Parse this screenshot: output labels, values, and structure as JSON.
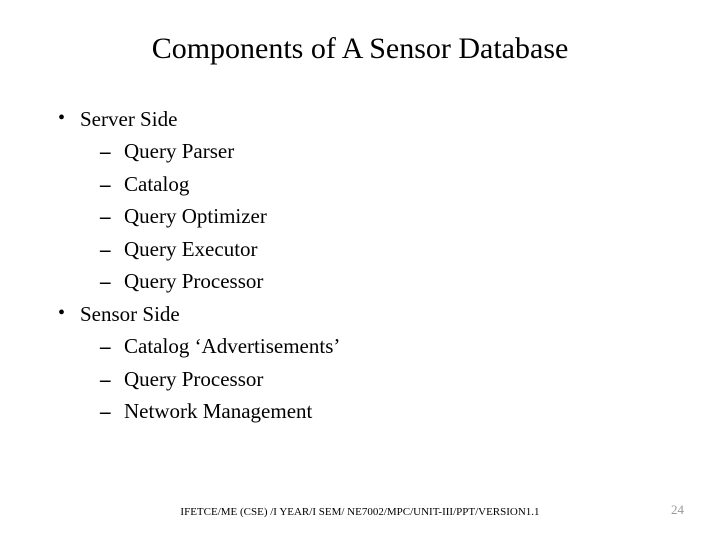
{
  "slide": {
    "title": "Components of A Sensor Database",
    "bullets": [
      {
        "label": "Server Side",
        "children": [
          "Query Parser",
          "Catalog",
          "Query Optimizer",
          "Query Executor",
          "Query Processor"
        ]
      },
      {
        "label": "Sensor Side",
        "children": [
          "Catalog ‘Advertisements’",
          "Query Processor",
          "Network Management"
        ]
      }
    ],
    "footer": "IFETCE/ME (CSE) /I YEAR/I SEM/ NE7002/MPC/UNIT-III/PPT/VERSION1.1",
    "page_number": "24"
  }
}
